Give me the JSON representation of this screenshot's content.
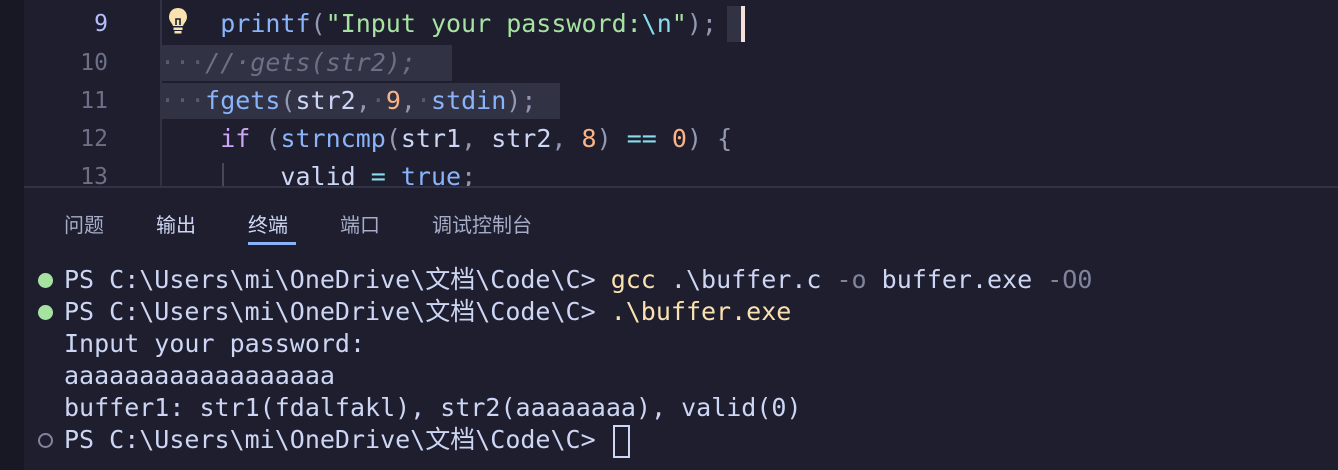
{
  "editor": {
    "lines": [
      {
        "number": "9",
        "active": true,
        "segments": [
          {
            "cls": "ws",
            "t": "    "
          },
          {
            "cls": "fn",
            "t": "printf"
          },
          {
            "cls": "punc",
            "t": "("
          },
          {
            "cls": "str",
            "t": "\"Input your password:"
          },
          {
            "cls": "op",
            "t": "\\n"
          },
          {
            "cls": "str",
            "t": "\""
          },
          {
            "cls": "punc",
            "t": ");"
          }
        ]
      },
      {
        "number": "10",
        "active": false,
        "segments": [
          {
            "cls": "ws",
            "t": "···"
          },
          {
            "cls": "cm",
            "t": "//·gets(str2);"
          }
        ]
      },
      {
        "number": "11",
        "active": false,
        "segments": [
          {
            "cls": "ws",
            "t": "···"
          },
          {
            "cls": "fn",
            "t": "fgets"
          },
          {
            "cls": "punc",
            "t": "("
          },
          {
            "cls": "dim",
            "t": "str2"
          },
          {
            "cls": "punc",
            "t": ","
          },
          {
            "cls": "ws",
            "t": "·"
          },
          {
            "cls": "num",
            "t": "9"
          },
          {
            "cls": "punc",
            "t": ","
          },
          {
            "cls": "ws",
            "t": "·"
          },
          {
            "cls": "fn",
            "t": "stdin"
          },
          {
            "cls": "punc",
            "t": ");"
          }
        ]
      },
      {
        "number": "12",
        "active": false,
        "segments": [
          {
            "cls": "ws",
            "t": "    "
          },
          {
            "cls": "kw",
            "t": "if"
          },
          {
            "cls": "dim",
            "t": " "
          },
          {
            "cls": "punc",
            "t": "("
          },
          {
            "cls": "fn",
            "t": "strncmp"
          },
          {
            "cls": "punc",
            "t": "("
          },
          {
            "cls": "dim",
            "t": "str1"
          },
          {
            "cls": "punc",
            "t": ","
          },
          {
            "cls": "dim",
            "t": " str2"
          },
          {
            "cls": "punc",
            "t": ","
          },
          {
            "cls": "dim",
            "t": " "
          },
          {
            "cls": "num",
            "t": "8"
          },
          {
            "cls": "punc",
            "t": ")"
          },
          {
            "cls": "dim",
            "t": " "
          },
          {
            "cls": "op",
            "t": "=="
          },
          {
            "cls": "dim",
            "t": " "
          },
          {
            "cls": "num",
            "t": "0"
          },
          {
            "cls": "punc",
            "t": ")"
          },
          {
            "cls": "dim",
            "t": " "
          },
          {
            "cls": "punc",
            "t": "{"
          }
        ]
      },
      {
        "number": "13",
        "active": false,
        "segments": [
          {
            "cls": "ws",
            "t": "        "
          },
          {
            "cls": "dim",
            "t": "valid "
          },
          {
            "cls": "op",
            "t": "="
          },
          {
            "cls": "dim",
            "t": " "
          },
          {
            "cls": "fn",
            "t": "true"
          },
          {
            "cls": "punc",
            "t": ";"
          }
        ]
      }
    ]
  },
  "panel": {
    "tabs": [
      {
        "label": "问题",
        "active": false
      },
      {
        "label": "输出",
        "active": false
      },
      {
        "label": "终端",
        "active": true
      },
      {
        "label": "端口",
        "active": false
      },
      {
        "label": "调试控制台",
        "active": false
      }
    ]
  },
  "terminal": {
    "lines": [
      {
        "status": "ok",
        "segments": [
          {
            "cls": "t-arg",
            "t": "PS C:\\Users\\mi\\OneDrive\\文档\\Code\\C> "
          },
          {
            "cls": "t-cmd",
            "t": "gcc"
          },
          {
            "cls": "t-arg",
            "t": " .\\buffer.c "
          },
          {
            "cls": "t-flag",
            "t": "-o"
          },
          {
            "cls": "t-arg",
            "t": " buffer.exe "
          },
          {
            "cls": "t-flag",
            "t": "-O0"
          }
        ]
      },
      {
        "status": "ok",
        "segments": [
          {
            "cls": "t-arg",
            "t": "PS C:\\Users\\mi\\OneDrive\\文档\\Code\\C> "
          },
          {
            "cls": "t-exe",
            "t": ".\\buffer.exe"
          }
        ]
      },
      {
        "status": "none",
        "segments": [
          {
            "cls": "t-arg",
            "t": "Input your password:"
          }
        ]
      },
      {
        "status": "none",
        "segments": [
          {
            "cls": "t-arg",
            "t": "aaaaaaaaaaaaaaaaaa"
          }
        ]
      },
      {
        "status": "none",
        "segments": [
          {
            "cls": "t-arg",
            "t": "buffer1: str1(fdalfakl), str2(aaaaaaaa), valid(0)"
          }
        ]
      },
      {
        "status": "open",
        "segments": [
          {
            "cls": "t-arg",
            "t": "PS C:\\Users\\mi\\OneDrive\\文档\\Code\\C> "
          }
        ]
      }
    ]
  }
}
